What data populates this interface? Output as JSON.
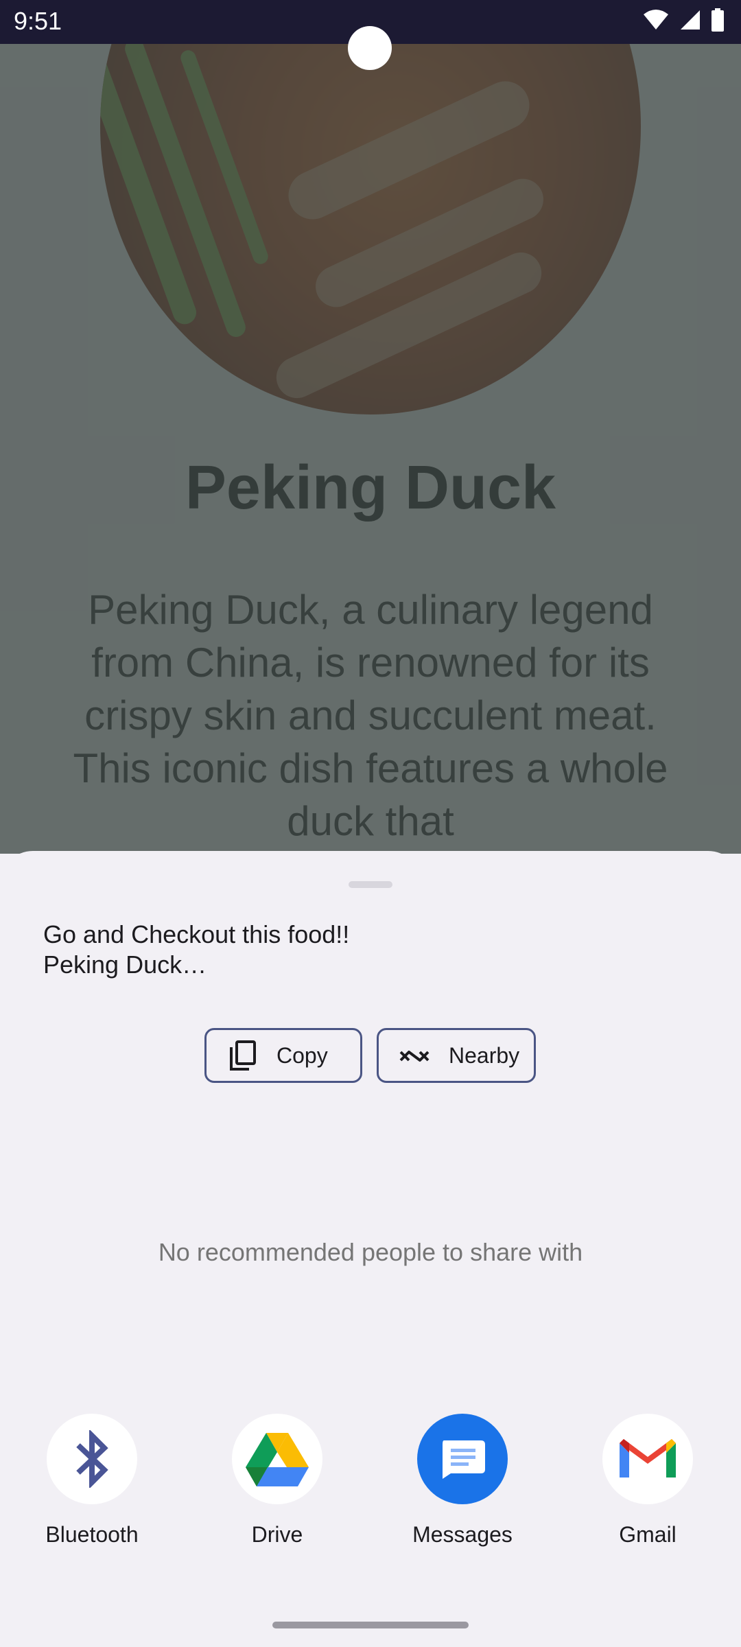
{
  "status_bar": {
    "time": "9:51"
  },
  "background_app": {
    "title": "Peking Duck",
    "description": "Peking Duck, a culinary legend from China, is renowned for its crispy skin and succulent meat. This iconic dish features a whole duck that"
  },
  "share_sheet": {
    "shared_text": "Go and Checkout this food!!\nPeking Duck…",
    "actions": [
      {
        "label": "Copy",
        "icon": "copy-icon"
      },
      {
        "label": "Nearby",
        "icon": "nearby-share-icon"
      }
    ],
    "empty_people_message": "No recommended people to share with",
    "targets": [
      {
        "label": "Bluetooth",
        "icon": "bluetooth-icon"
      },
      {
        "label": "Drive",
        "icon": "google-drive-icon"
      },
      {
        "label": "Messages",
        "icon": "messages-icon"
      },
      {
        "label": "Gmail",
        "icon": "gmail-icon"
      }
    ]
  },
  "colors": {
    "status_bar": "#1c1a33",
    "sheet_background": "#f2f0f5",
    "button_outline": "#4a5584",
    "messages_blue": "#1a73e8",
    "bluetooth_blue": "#4a5596"
  }
}
